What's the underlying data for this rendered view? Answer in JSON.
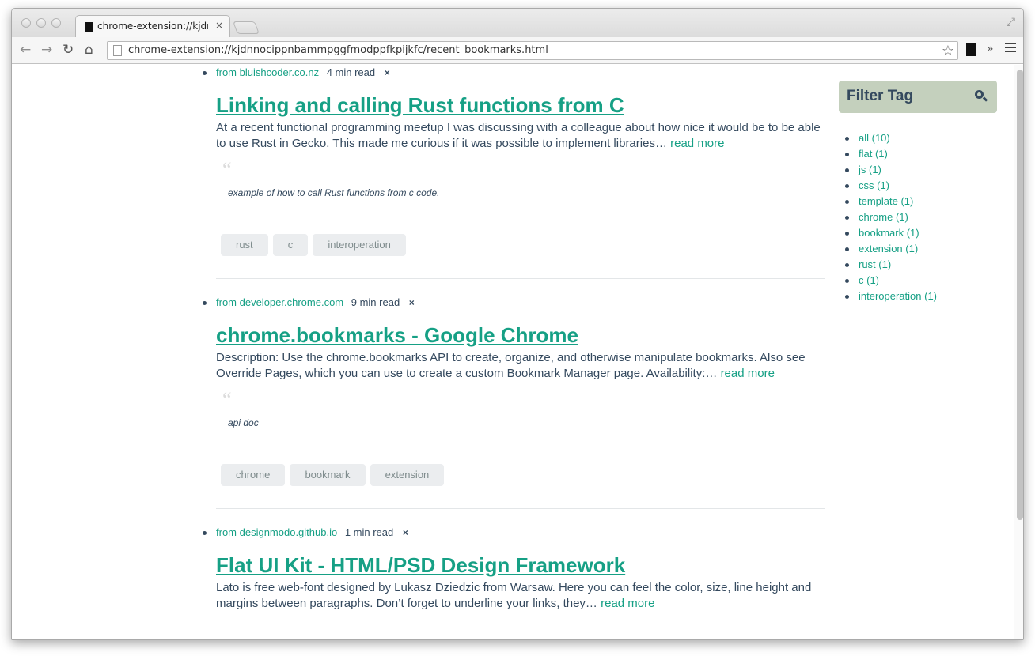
{
  "browser": {
    "tab_title": "chrome-extension://kjdnn",
    "tab_close": "×",
    "url": "chrome-extension://kjdnnocippnbammpggfmodppfkpijkfc/recent_bookmarks.html"
  },
  "entries": [
    {
      "source": "from bluishcoder.co.nz",
      "read_time": "4 min read",
      "remove": "×",
      "title": "Linking and calling Rust functions from C",
      "description": "At a recent functional programming meetup I was discussing with a colleague about how nice it would be to be able to use Rust in Gecko. This made me curious if it was possible to implement libraries…",
      "read_more": "read more",
      "quote_mark": "“",
      "note": "example of how to call Rust functions from c code.",
      "tags": [
        "rust",
        "c",
        "interoperation"
      ]
    },
    {
      "source": "from developer.chrome.com",
      "read_time": "9 min read",
      "remove": "×",
      "title": "chrome.bookmarks - Google Chrome",
      "description": "Description: Use the chrome.bookmarks API to create, organize, and otherwise manipulate bookmarks. Also see Override Pages, which you can use to create a custom Bookmark Manager page. Availability:…",
      "read_more": "read more",
      "quote_mark": "“",
      "note": "api doc",
      "tags": [
        "chrome",
        "bookmark",
        "extension"
      ]
    },
    {
      "source": "from designmodo.github.io",
      "read_time": "1 min read",
      "remove": "×",
      "title": "Flat UI Kit - HTML/PSD Design Framework",
      "description": "Lato is free web-font designed by Lukasz Dziedzic from Warsaw. Here you can feel the color, size, line height and margins between paragraphs. Don’t forget to underline your links, they…",
      "read_more": "read more"
    }
  ],
  "sidebar": {
    "title": "Filter Tag",
    "tags": [
      "all (10)",
      "flat (1)",
      "js (1)",
      "css (1)",
      "template (1)",
      "chrome (1)",
      "bookmark (1)",
      "extension (1)",
      "rust (1)",
      "c (1)",
      "interoperation (1)"
    ]
  },
  "colors": {
    "accent": "#16a085",
    "text": "#34495e",
    "filter_header": "#c4d0bd",
    "tag_bg": "#ebedef"
  }
}
